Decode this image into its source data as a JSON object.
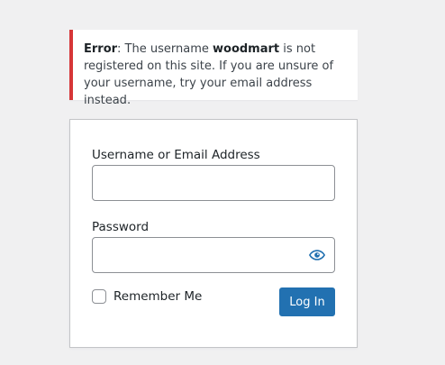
{
  "logo": {
    "icon": "wordpress-logo-icon",
    "color": "#2271b1"
  },
  "notice": {
    "error_label": "Error",
    "text_before_user": ": The username ",
    "username": "woodmart",
    "text_after_user": " is not registered on this site. If you are unsure of your username, try your email address instead.",
    "accent_color": "#d63638"
  },
  "form": {
    "username_label": "Username or Email Address",
    "username_value": "",
    "password_label": "Password",
    "password_value": "",
    "show_password_icon": "eye-icon",
    "remember_label": "Remember Me",
    "remember_checked": false,
    "login_label": "Log In",
    "button_color": "#2271b1"
  }
}
